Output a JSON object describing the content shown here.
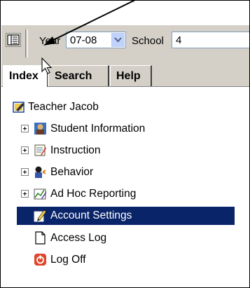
{
  "toolbar": {
    "year_label": "Year",
    "year_value": "07-08",
    "school_label": "School",
    "school_value": "4"
  },
  "tabs": [
    {
      "label": "Index"
    },
    {
      "label": "Search"
    },
    {
      "label": "Help"
    }
  ],
  "tree": {
    "root": "Teacher Jacob",
    "items": [
      {
        "label": "Student Information"
      },
      {
        "label": "Instruction"
      },
      {
        "label": "Behavior"
      },
      {
        "label": "Ad Hoc Reporting"
      },
      {
        "label": "Account Settings"
      },
      {
        "label": "Access Log"
      },
      {
        "label": "Log Off"
      }
    ]
  },
  "colors": {
    "selection": "#0a246a",
    "toolbar": "#d4d0c8"
  },
  "icons": [
    "menu-icon",
    "chevron-down-icon",
    "teacher-icon",
    "student-icon",
    "instruction-icon",
    "behavior-icon",
    "report-icon",
    "settings-icon",
    "document-icon",
    "logoff-icon",
    "mouse-cursor-icon",
    "annotation-arrow-icon"
  ]
}
